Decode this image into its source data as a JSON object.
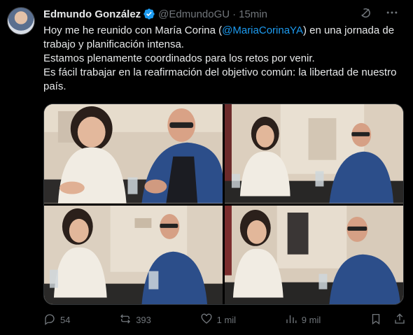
{
  "author": {
    "name": "Edmundo González",
    "handle": "@EdmundoGU",
    "separator": "·",
    "time": "15min"
  },
  "tweet": {
    "line1_before": "Hoy me he reunido con María Corina (",
    "mention": "@MariaCorinaYA",
    "line1_after": ") en una jornada de trabajo y planificación intensa.",
    "line2": "Estamos plenamente coordinados para los retos por venir.",
    "line3": "Es fácil trabajar en la reafirmación del objetivo común: la libertad de nuestro país."
  },
  "media": {
    "photo_count": 4
  },
  "actions": {
    "replies": "54",
    "reposts": "393",
    "likes": "1 mil",
    "views": "9 mil"
  },
  "icons": [
    "verified-badge-icon",
    "grok-icon",
    "more-icon",
    "reply-icon",
    "repost-icon",
    "like-icon",
    "views-icon",
    "bookmark-icon",
    "share-icon"
  ],
  "colors": {
    "background": "#000000",
    "text": "#e7e9ea",
    "secondary": "#71767b",
    "accent": "#1d9bf0"
  }
}
